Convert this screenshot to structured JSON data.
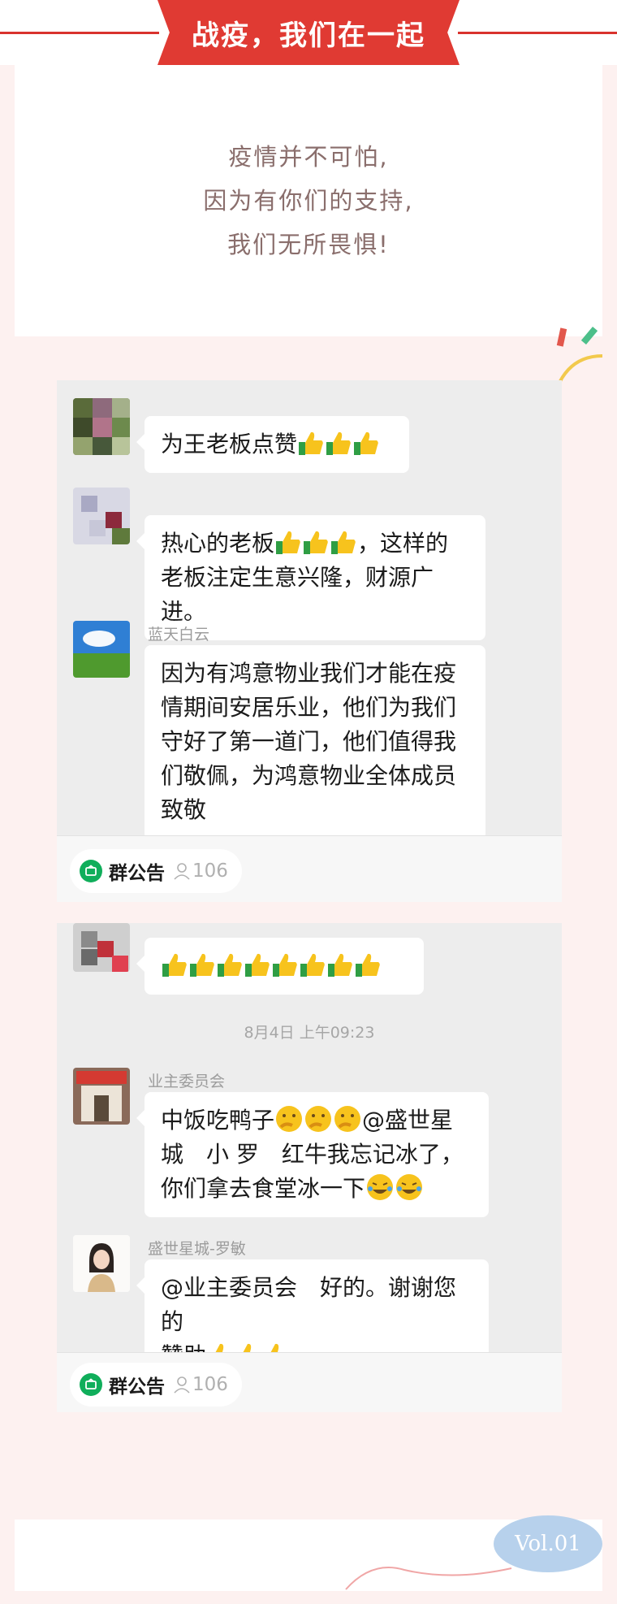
{
  "header": {
    "title": "战疫，我们在一起"
  },
  "intro": {
    "lines": [
      "疫情并不可怕,",
      "因为有你们的支持,",
      "我们无所畏惧!"
    ]
  },
  "card1": {
    "messages": [
      {
        "text": "为王老板点赞"
      },
      {
        "text_a": "热心的老板",
        "text_b": "，这样的",
        "text_c": "老板注定生意兴隆，财源广进。"
      },
      {
        "name": "蓝天白云",
        "text": "因为有鸿意物业我们才能在疫情期间安居乐业，他们为我们守好了第一道门，他们值得我们敬佩，为鸿意物业全体成员致敬"
      }
    ],
    "notice": {
      "label": "群公告",
      "count": "106"
    }
  },
  "card2": {
    "timestamp": "8月4日 上午09:23",
    "messages": [
      {
        "name": "业主委员会",
        "text_a": "中饭吃鸭子",
        "text_b": "@盛世星",
        "text_c": "城　小 罗　红牛我忘记冰了，",
        "text_d": "你们拿去食堂冰一下"
      },
      {
        "name": "盛世星城-罗敏",
        "text_a": "@业主委员会　好的。谢谢您的",
        "text_b": "赞助"
      }
    ],
    "notice": {
      "label": "群公告",
      "count": "106"
    }
  },
  "footer": {
    "vol": "Vol.01"
  },
  "colors": {
    "accent": "#e03a33",
    "panel": "#ededed",
    "group_green": "#10ae5b",
    "vol_badge": "#b7d1ec"
  },
  "icons": [
    "thumbs-up-icon",
    "thinking-face-icon",
    "laughing-tears-icon",
    "group-notice-icon",
    "person-icon"
  ]
}
